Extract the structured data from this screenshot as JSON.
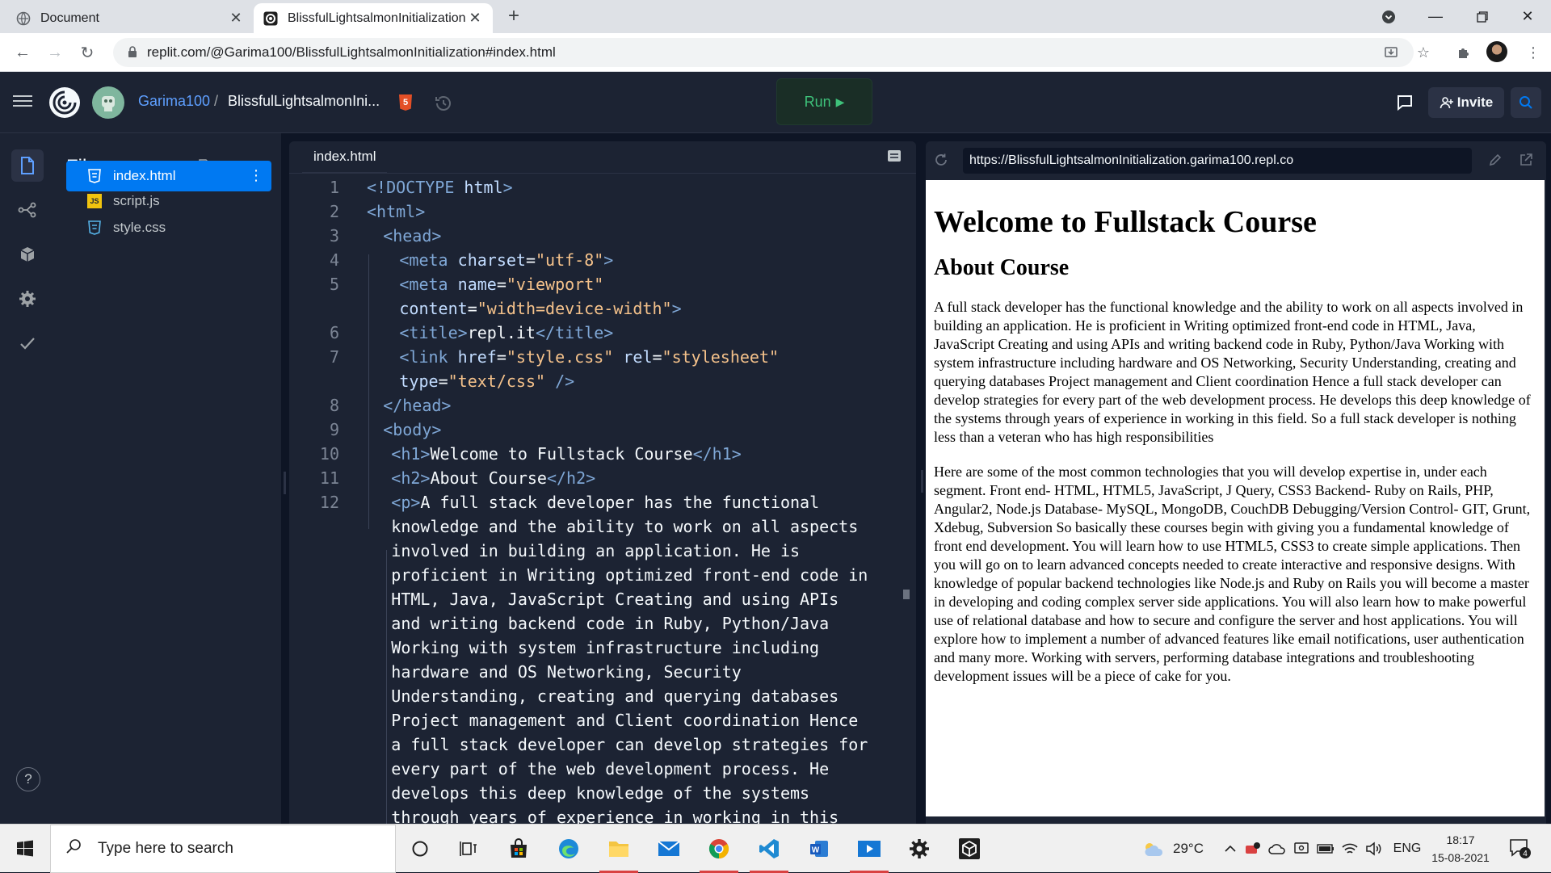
{
  "browser": {
    "tabs": [
      {
        "title": "Document",
        "active": false
      },
      {
        "title": "BlissfulLightsalmonInitialization -",
        "active": true
      }
    ],
    "url": "replit.com/@Garima100/BlissfulLightsalmonInitialization#index.html"
  },
  "header": {
    "username": "Garima100",
    "separator": "/",
    "repl_name": "BlissfulLightsalmonIni...",
    "language_badge": "5",
    "run_label": "Run",
    "invite_label": "Invite"
  },
  "files": {
    "title": "Files",
    "items": [
      {
        "name": "index.html",
        "type": "html",
        "active": true
      },
      {
        "name": "script.js",
        "type": "js",
        "active": false
      },
      {
        "name": "style.css",
        "type": "css",
        "active": false
      }
    ]
  },
  "rail": {
    "help_label": "?"
  },
  "editor": {
    "tab": "index.html",
    "lines": [
      {
        "n": "1",
        "html": "<span class=\"tg\">&lt;!DOCTYPE</span> <span class=\"at\">html</span><span class=\"tg\">&gt;</span>",
        "indent": 0
      },
      {
        "n": "2",
        "html": "<span class=\"tg\">&lt;html&gt;</span>",
        "indent": 0
      },
      {
        "n": "3",
        "html": "<span class=\"tg\">&lt;head&gt;</span>",
        "indent": 2
      },
      {
        "n": "4",
        "html": "<span class=\"tg\">&lt;meta</span> <span class=\"at\">charset</span><span class=\"tx\">=</span><span class=\"st\">\"utf-8\"</span><span class=\"tg\">&gt;</span>",
        "indent": 4
      },
      {
        "n": "5",
        "html": "<span class=\"tg\">&lt;meta</span> <span class=\"at\">name</span><span class=\"tx\">=</span><span class=\"st\">\"viewport\"</span>",
        "indent": 4
      },
      {
        "n": "",
        "html": "<span class=\"at\">content</span><span class=\"tx\">=</span><span class=\"st\">\"width=device-width\"</span><span class=\"tg\">&gt;</span>",
        "indent": 4
      },
      {
        "n": "6",
        "html": "<span class=\"tg\">&lt;title&gt;</span><span class=\"tx\">repl.it</span><span class=\"tg\">&lt;/title&gt;</span>",
        "indent": 4
      },
      {
        "n": "7",
        "html": "<span class=\"tg\">&lt;link</span> <span class=\"at\">href</span><span class=\"tx\">=</span><span class=\"st\">\"style.css\"</span> <span class=\"at\">rel</span><span class=\"tx\">=</span><span class=\"st\">\"stylesheet\"</span>",
        "indent": 4
      },
      {
        "n": "",
        "html": "<span class=\"at\">type</span><span class=\"tx\">=</span><span class=\"st\">\"text/css\"</span> <span class=\"tg\">/&gt;</span>",
        "indent": 4
      },
      {
        "n": "8",
        "html": "<span class=\"tg\">&lt;/head&gt;</span>",
        "indent": 2
      },
      {
        "n": "9",
        "html": "<span class=\"tg\">&lt;body&gt;</span>",
        "indent": 2
      },
      {
        "n": "10",
        "html": "<span class=\"tg\">&lt;h1&gt;</span><span class=\"tx\">Welcome to Fullstack Course</span><span class=\"tg\">&lt;/h1&gt;</span>",
        "indent": 3
      },
      {
        "n": "11",
        "html": "<span class=\"tg\">&lt;h2&gt;</span><span class=\"tx\">About Course</span><span class=\"tg\">&lt;/h2&gt;</span>",
        "indent": 3
      },
      {
        "n": "12",
        "html": "<span class=\"tg\">&lt;p&gt;</span><span class=\"tx\">A full stack developer has the functional</span>",
        "indent": 3
      },
      {
        "n": "",
        "html": "<span class=\"tx\">knowledge and the ability to work on all aspects</span>",
        "indent": 3
      },
      {
        "n": "",
        "html": "<span class=\"tx\">involved in building an application. He is</span>",
        "indent": 3
      },
      {
        "n": "",
        "html": "<span class=\"tx\">proficient in Writing optimized front-end code in</span>",
        "indent": 3
      },
      {
        "n": "",
        "html": "<span class=\"tx\">HTML, Java, JavaScript Creating and using APIs</span>",
        "indent": 3
      },
      {
        "n": "",
        "html": "<span class=\"tx\">and writing backend code in Ruby, Python/Java</span>",
        "indent": 3
      },
      {
        "n": "",
        "html": "<span class=\"tx\">Working with system infrastructure including</span>",
        "indent": 3
      },
      {
        "n": "",
        "html": "<span class=\"tx\">hardware and OS Networking, Security</span>",
        "indent": 3
      },
      {
        "n": "",
        "html": "<span class=\"tx\">Understanding, creating and querying databases</span>",
        "indent": 3
      },
      {
        "n": "",
        "html": "<span class=\"tx\">Project management and Client coordination Hence</span>",
        "indent": 3
      },
      {
        "n": "",
        "html": "<span class=\"tx\">a full stack developer can develop strategies for</span>",
        "indent": 3
      },
      {
        "n": "",
        "html": "<span class=\"tx\">every part of the web development process. He</span>",
        "indent": 3
      },
      {
        "n": "",
        "html": "<span class=\"tx\">develops this deep knowledge of the systems</span>",
        "indent": 3
      },
      {
        "n": "",
        "html": "<span class=\"tx\">through years of experience in working in this</span>",
        "indent": 3
      }
    ]
  },
  "webview": {
    "url": "https://BlissfulLightsalmonInitialization.garima100.repl.co",
    "h1": "Welcome to Fullstack Course",
    "h2": "About Course",
    "p1": "A full stack developer has the functional knowledge and the ability to work on all aspects involved in building an application. He is proficient in Writing optimized front-end code in HTML, Java, JavaScript Creating and using APIs and writing backend code in Ruby, Python/Java Working with system infrastructure including hardware and OS Networking, Security Understanding, creating and querying databases Project management and Client coordination Hence a full stack developer can develop strategies for every part of the web development process. He develops this deep knowledge of the systems through years of experience in working in this field. So a full stack developer is nothing less than a veteran who has high responsibilities",
    "p2": "Here are some of the most common technologies that you will develop expertise in, under each segment. Front end- HTML, HTML5, JavaScript, J Query, CSS3 Backend- Ruby on Rails, PHP, Angular2, Node.js Database- MySQL, MongoDB, CouchDB Debugging/Version Control- GIT, Grunt, Xdebug, Subversion So basically these courses begin with giving you a fundamental knowledge of front end development. You will learn how to use HTML5, CSS3 to create simple applications. Then you will go on to learn advanced concepts needed to create interactive and responsive designs. With knowledge of popular backend technologies like Node.js and Ruby on Rails you will become a master in developing and coding complex server side applications. You will also learn how to make powerful use of relational database and how to secure and configure the server and host applications. You will explore how to implement a number of advanced features like email notifications, user authentication and many more. Working with servers, performing database integrations and troubleshooting development issues will be a piece of cake for you."
  },
  "taskbar": {
    "search_placeholder": "Type here to search",
    "weather": "29°C",
    "language": "ENG",
    "time": "18:17",
    "date": "15-08-2021",
    "notification_count": "4"
  }
}
